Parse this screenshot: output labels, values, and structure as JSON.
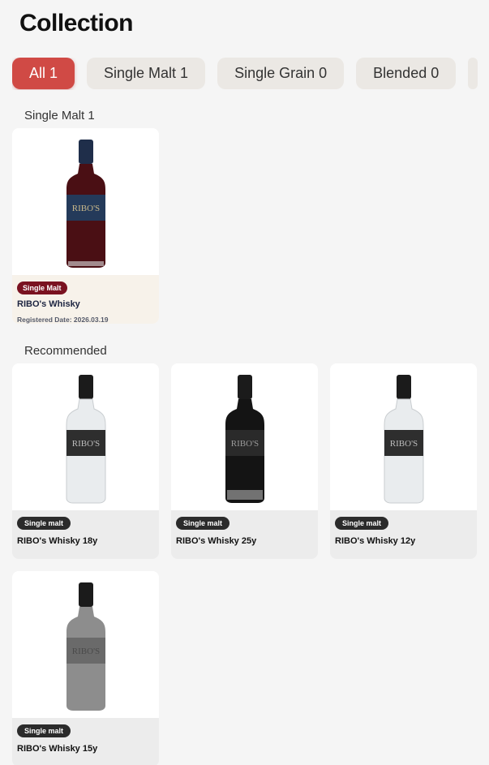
{
  "header": {
    "title": "Collection"
  },
  "tabs": [
    {
      "label": "All 1",
      "active": true
    },
    {
      "label": "Single Malt 1",
      "active": false
    },
    {
      "label": "Single Grain 0",
      "active": false
    },
    {
      "label": "Blended 0",
      "active": false
    }
  ],
  "sections": {
    "owned_title": "Single Malt 1",
    "recommended_title": "Recommended"
  },
  "owned": [
    {
      "badge": "Single Malt",
      "name": "RIBO's Whisky",
      "date": "Registered Date: 2026.03.19",
      "bottle_color": "#4a0f14",
      "cap_color": "#1f2e4a",
      "label_text": "RIBO'S"
    }
  ],
  "recommended": [
    {
      "badge": "Single malt",
      "name": "RIBO's Whisky 18y",
      "bottle_color": "#e9ecee",
      "label_text": "RIBO'S"
    },
    {
      "badge": "Single malt",
      "name": "RIBO's Whisky 25y",
      "bottle_color": "#141414",
      "label_text": "RIBO'S"
    },
    {
      "badge": "Single malt",
      "name": "RIBO's Whisky 12y",
      "bottle_color": "#e9ecee",
      "label_text": "RIBO'S"
    },
    {
      "badge": "Single malt",
      "name": "RIBO's Whisky 15y",
      "bottle_color": "#8d8d8d",
      "label_text": "RIBO'S"
    }
  ],
  "colors": {
    "accent": "#d04a45",
    "owned_badge": "#7a1220",
    "rec_badge": "#2b2b2b"
  }
}
